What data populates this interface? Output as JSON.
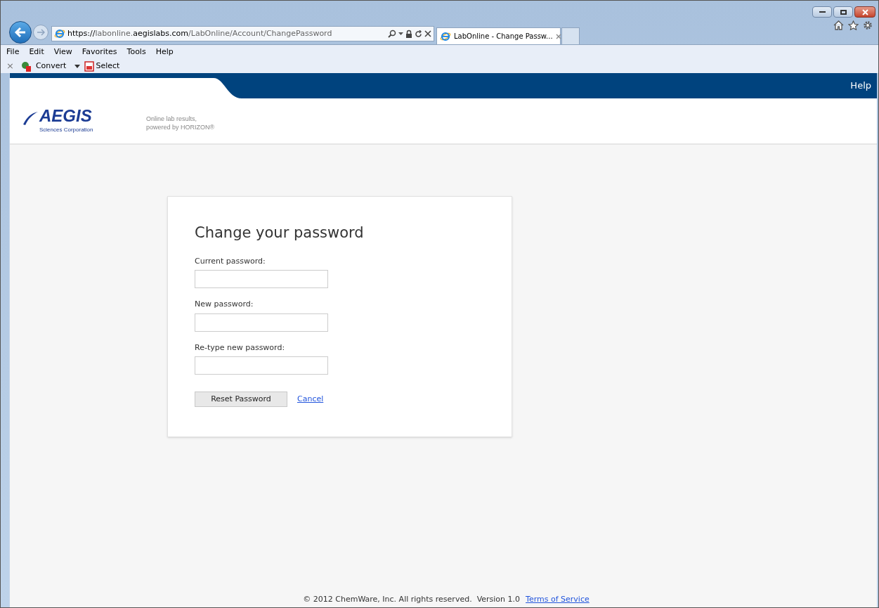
{
  "browser": {
    "address": {
      "scheme": "https://",
      "subdomain": "labonline.",
      "domain": "aegislabs.com",
      "path": "/LabOnline/Account/ChangePassword"
    },
    "tabs": [
      {
        "title": "LabOnline - Change Passw...",
        "selected": true
      }
    ],
    "menu": [
      "File",
      "Edit",
      "View",
      "Favorites",
      "Tools",
      "Help"
    ],
    "toolbar": [
      {
        "kind": "close",
        "label": "×"
      },
      {
        "kind": "convert",
        "label": "Convert"
      },
      {
        "kind": "select",
        "label": "Select"
      }
    ]
  },
  "header": {
    "nav": [
      "Help"
    ],
    "logo": {
      "name": "AEGIS",
      "subtitle": "Sciences Corporation"
    },
    "tagline": [
      "Online lab results,",
      "powered by HORIZON®"
    ]
  },
  "form": {
    "title": "Change your password",
    "fields": [
      {
        "label": "Current password:"
      },
      {
        "label": "New password:"
      },
      {
        "label": "Re-type new password:"
      }
    ],
    "submit": "Reset Password",
    "cancel": "Cancel"
  },
  "footer": {
    "text": "© 2012 ChemWare, Inc. All rights reserved.  Version 1.0",
    "link": "Terms of Service"
  }
}
